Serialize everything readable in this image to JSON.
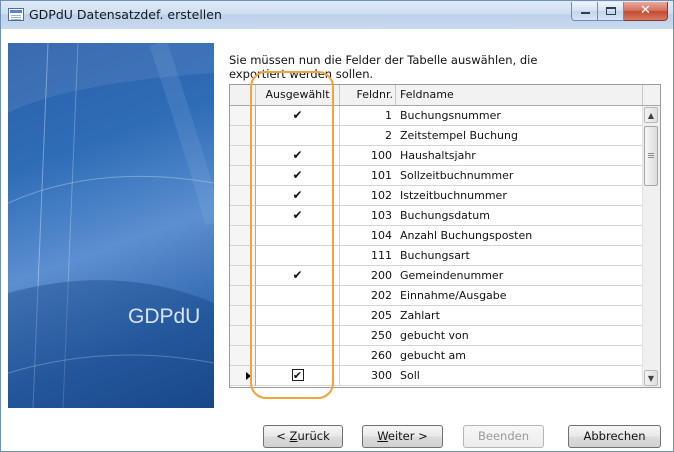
{
  "window": {
    "title": "GDPdU Datensatzdef. erstellen"
  },
  "banner": {
    "text": "GDPdU"
  },
  "instruction": "Sie müssen nun die Felder der Tabelle auswählen, die exportiert werden sollen.",
  "grid": {
    "columns": [
      "Ausgewählt",
      "Feldnr.",
      "Feldname"
    ],
    "rows": [
      {
        "selected": true,
        "nr": "1",
        "name": "Buchungsnummer"
      },
      {
        "selected": false,
        "nr": "2",
        "name": "Zeitstempel Buchung"
      },
      {
        "selected": true,
        "nr": "100",
        "name": "Haushaltsjahr"
      },
      {
        "selected": true,
        "nr": "101",
        "name": "Sollzeitbuchnummer"
      },
      {
        "selected": true,
        "nr": "102",
        "name": "Istzeitbuchnummer"
      },
      {
        "selected": true,
        "nr": "103",
        "name": "Buchungsdatum"
      },
      {
        "selected": false,
        "nr": "104",
        "name": "Anzahl Buchungsposten"
      },
      {
        "selected": false,
        "nr": "111",
        "name": "Buchungsart"
      },
      {
        "selected": true,
        "nr": "200",
        "name": "Gemeindenummer"
      },
      {
        "selected": false,
        "nr": "202",
        "name": "Einnahme/Ausgabe"
      },
      {
        "selected": false,
        "nr": "205",
        "name": "Zahlart"
      },
      {
        "selected": false,
        "nr": "250",
        "name": "gebucht von"
      },
      {
        "selected": false,
        "nr": "260",
        "name": "gebucht am"
      },
      {
        "selected": true,
        "nr": "300",
        "name": "Soll",
        "current": true
      }
    ]
  },
  "buttons": {
    "back": {
      "prefix": "< ",
      "hotkey": "Z",
      "rest": "urück"
    },
    "next": {
      "hotkey": "W",
      "rest": "eiter >"
    },
    "finish": {
      "label": "Beenden"
    },
    "cancel": {
      "label": "Abbrechen"
    }
  },
  "colors": {
    "highlight": "#f2a33a",
    "titlebar": "#c9daef",
    "banner": "#2f6db7"
  }
}
